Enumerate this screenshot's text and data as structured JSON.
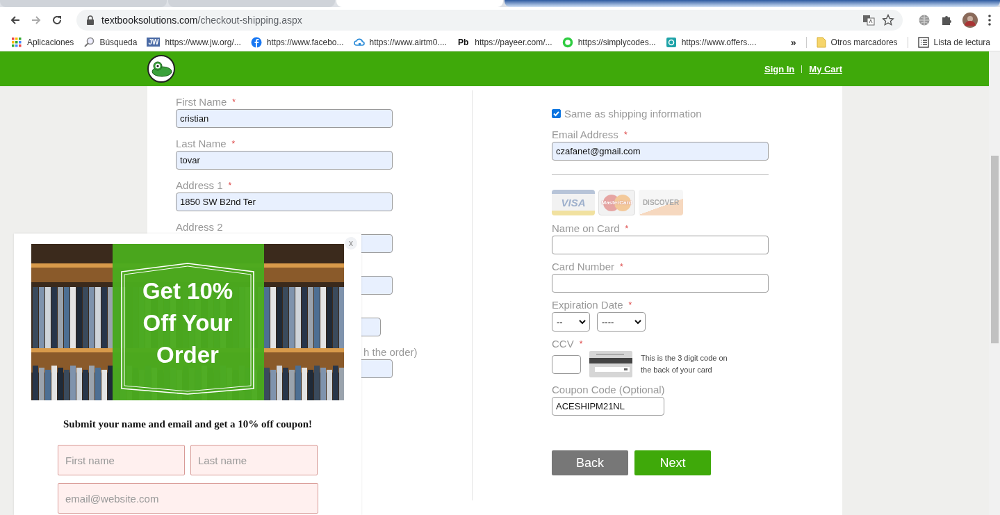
{
  "browser": {
    "url": {
      "domain": "textbooksolutions.com",
      "path": "/checkout-shipping.aspx"
    },
    "bookmarks": [
      {
        "kind": "apps",
        "label": "Aplicaciones"
      },
      {
        "kind": "search",
        "label": "Búsqueda"
      },
      {
        "kind": "letters",
        "badge": "JW",
        "label": "https://www.jw.org/..."
      },
      {
        "kind": "facebook",
        "label": "https://www.facebo..."
      },
      {
        "kind": "cloud",
        "label": "https://www.airtm0...."
      },
      {
        "kind": "letters",
        "badge": "Pb",
        "label": "https://payeer.com/..."
      },
      {
        "kind": "ring",
        "label": "https://simplycodes..."
      },
      {
        "kind": "tile",
        "label": "https://www.offers...."
      }
    ],
    "more": "»",
    "other_bookmarks": "Otros marcadores",
    "reading_list": "Lista de lectura"
  },
  "header": {
    "links": [
      "Sign In",
      "My Cart"
    ]
  },
  "shipping": {
    "rows": [
      {
        "kind": "wide",
        "label": "First Name",
        "required_mark": "*",
        "value": "cristian"
      },
      {
        "kind": "wide",
        "label": "Last Name",
        "required_mark": "*",
        "value": "tovar"
      },
      {
        "kind": "wide",
        "label": "Address 1",
        "required_mark": "*",
        "value": "1850 SW B2nd Ter"
      },
      {
        "kind": "wide",
        "label": "Address 2"
      },
      {
        "kind": "wide"
      },
      {
        "kind": "narrow"
      },
      {
        "kind": "wide",
        "label": "h the order)"
      }
    ]
  },
  "billing": {
    "same_as_shipping": {
      "label": "Same as shipping information",
      "checked": true
    },
    "email": {
      "label": "Email Address",
      "required_mark": "*",
      "value": "czafanet@gmail.com"
    },
    "card_brands": [
      {
        "kind": "visa",
        "text": "VISA"
      },
      {
        "kind": "mastercard",
        "text": "MasterCard"
      },
      {
        "kind": "discover",
        "text": "DISCOVER"
      }
    ],
    "name_on_card": {
      "label": "Name on Card",
      "required_mark": "*"
    },
    "card_number": {
      "label": "Card Number",
      "required_mark": "*"
    },
    "expiration": {
      "label": "Expiration Date",
      "required_mark": "*",
      "month": "--",
      "year": "----"
    },
    "ccv": {
      "label": "CCV",
      "required_mark": "*",
      "hint": "This is the 3 digit code on the back of your card"
    },
    "coupon": {
      "label": "Coupon Code (Optional)",
      "value": "ACESHIPM21NL"
    },
    "buttons": [
      {
        "kind": "secondary",
        "label": "Back"
      },
      {
        "kind": "primary",
        "label": "Next"
      }
    ]
  },
  "popup": {
    "close": "x",
    "headline": "Get 10% Off Your Order",
    "message": "Submit your name and email and get a 10% off coupon!",
    "fields": [
      {
        "placeholder": "First name"
      },
      {
        "placeholder": "Last name"
      },
      {
        "placeholder": "email@website.com"
      }
    ]
  }
}
